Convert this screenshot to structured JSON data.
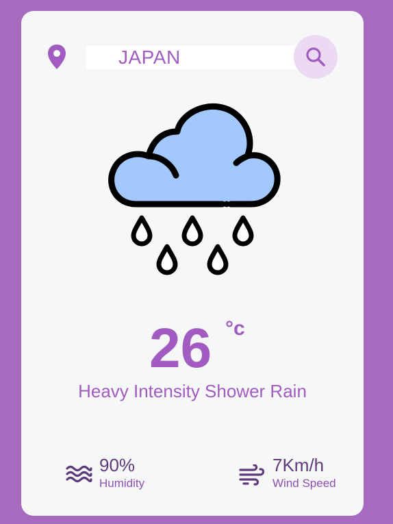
{
  "search": {
    "value": "JAPAN",
    "icon_location": "map-pin-icon",
    "icon_search": "magnifier-icon"
  },
  "weather": {
    "icon": "rain-cloud-icon",
    "temperature": "26",
    "unit": "°c",
    "description": "Heavy Intensity Shower Rain"
  },
  "stats": {
    "humidity": {
      "value": "90%",
      "label": "Humidity",
      "icon": "waves-icon"
    },
    "wind": {
      "value": "7Km/h",
      "label": "Wind Speed",
      "icon": "wind-icon"
    }
  },
  "colors": {
    "background": "#a66bbe",
    "card": "#f6f7f7",
    "accent": "#a25bc1",
    "search_button_bg": "#ebdaf1",
    "cloud_fill": "#a2c8fd",
    "stat_text": "#5e3a7a"
  }
}
